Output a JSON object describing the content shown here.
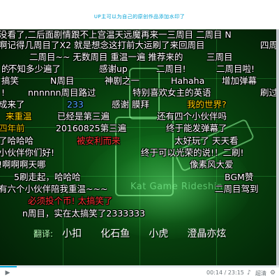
{
  "notice": {
    "text": "UP主可以为自己的原创作品添加水印了"
  },
  "video": {
    "watermark": "Kat Game Rideshin",
    "danmaku": [
      {
        "text": "没看了,二后面剧情跟不上宫温天远魔再来一三周目 二周目 N",
        "color": "#ffffff"
      },
      {
        "text": "啊记得几周目了X2 就是想念这打前大运刷了来回周目",
        "color": "#ffffff"
      },
      {
        "text": "四周",
        "color": "#ffffff"
      },
      {
        "text": "二周目~~ 无数周目 重温一遍 推荐来的",
        "color": "#ffffff"
      },
      {
        "text": "三周目",
        "color": "#ffffff"
      },
      {
        "text": "的",
        "color": "#ffffff"
      },
      {
        "text": "不知多少遍了",
        "color": "#ffffff"
      },
      {
        "text": "感谢up",
        "color": "#ffffff"
      },
      {
        "text": "二周目!",
        "color": "#ffffff"
      },
      {
        "text": "二周目啦!",
        "color": "#ffffff"
      },
      {
        "text": "搞笑",
        "color": "#ffffff"
      },
      {
        "text": "N周目",
        "color": "#ffffff"
      },
      {
        "text": "神剧之一",
        "color": "#ffffff"
      },
      {
        "text": "Hahaha",
        "color": "#ffffff"
      },
      {
        "text": "增加弹幕",
        "color": "#ffffff"
      },
      {
        "text": "!",
        "color": "#ffffff"
      },
      {
        "text": "nnnnnn周目路过",
        "color": "#ffffff"
      },
      {
        "text": "特别喜欢女主的英语",
        "color": "#ffffff"
      },
      {
        "text": "刷过",
        "color": "#ffffff"
      },
      {
        "text": "成来了",
        "color": "#ffffff"
      },
      {
        "text": "233",
        "color": "#4fa8ff"
      },
      {
        "text": "感谢 膜拜",
        "color": "#ffffff"
      },
      {
        "text": "我的世界?",
        "color": "#ffd400"
      },
      {
        "text": "来重温",
        "color": "#ffd400"
      },
      {
        "text": "已经是第三遍",
        "color": "#ffffff"
      },
      {
        "text": "还有四个小伙伴吗",
        "color": "#ffffff"
      },
      {
        "text": "四年前",
        "color": "#e0c000"
      },
      {
        "text": "20160825第三遍",
        "color": "#ffffff"
      },
      {
        "text": "终于能发弹幕了",
        "color": "#ffffff"
      },
      {
        "text": "了哈哈哈",
        "color": "#ffffff"
      },
      {
        "text": "被安利而来",
        "color": "#ff3333"
      },
      {
        "text": "太好玩了 天天看",
        "color": "#ffffff"
      },
      {
        "text": "小伙伴你们好!",
        "color": "#ffffff"
      },
      {
        "text": "终于可以光荣的说!！二刷!",
        "color": "#ffffff"
      },
      {
        "text": "!啊啊啊天哪",
        "color": "#ffffff"
      },
      {
        "text": "像素风大爱",
        "color": "#ffffff"
      },
      {
        "text": "5刷走起，哈哈哈",
        "color": "#ffffff"
      },
      {
        "text": "BGM赞",
        "color": "#ffffff"
      },
      {
        "text": "有六个小伙伴陪我重温~~~",
        "color": "#ffffff"
      },
      {
        "text": "二周目驾到",
        "color": "#ffffff"
      },
      {
        "text": "必须投个币! 太搞笑了",
        "color": "#ff3333"
      },
      {
        "text": "n周目，实在太搞笑了2333333",
        "color": "#ffffff"
      }
    ],
    "subtitle": {
      "label": "翻译:",
      "names": [
        "小扣",
        "化石鱼",
        "小虎",
        "澄晶亦炫"
      ]
    }
  },
  "controls": {
    "progress": 0.06,
    "time_current": "00:14",
    "time_total": "23:15",
    "quality": "超清",
    "play_icon": "play-icon",
    "volume_icon": "volume-icon",
    "settings_icon": "gear-icon",
    "danmaku_icon": "danmaku-icon"
  }
}
